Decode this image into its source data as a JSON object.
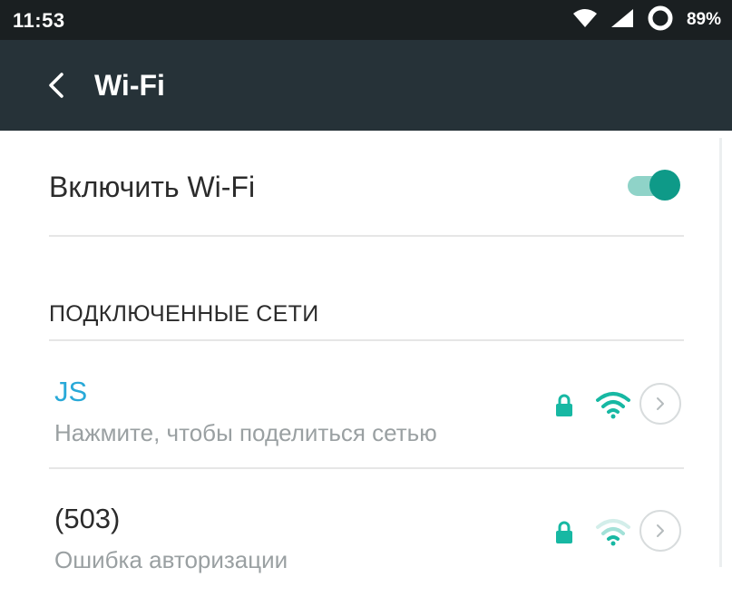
{
  "status_bar": {
    "time": "11:53",
    "battery": "89%",
    "icons": [
      "wifi-icon",
      "cell-signal-icon",
      "battery-ring-icon"
    ]
  },
  "app_bar": {
    "title": "Wi-Fi",
    "back_icon": "chevron-left-icon"
  },
  "wifi_toggle": {
    "label": "Включить Wi-Fi",
    "enabled": true,
    "accent": "#0e9a88"
  },
  "connected_section": {
    "header": "ПОДКЛЮЧЕННЫЕ СЕТИ",
    "networks": [
      {
        "name": "JS",
        "status": "Нажмите, чтобы поделиться сетью",
        "secured": true,
        "name_color": "#29a9d8",
        "signal_color": "#17b8a3"
      },
      {
        "name": "(503)",
        "status": "Ошибка авторизации",
        "secured": true,
        "name_color": "#2b2b2b",
        "signal_color": "#a3e1d8"
      }
    ]
  },
  "colors": {
    "status_bar_bg": "#1a1f21",
    "app_bar_bg": "#263238",
    "accent_teal": "#17b8a3"
  }
}
